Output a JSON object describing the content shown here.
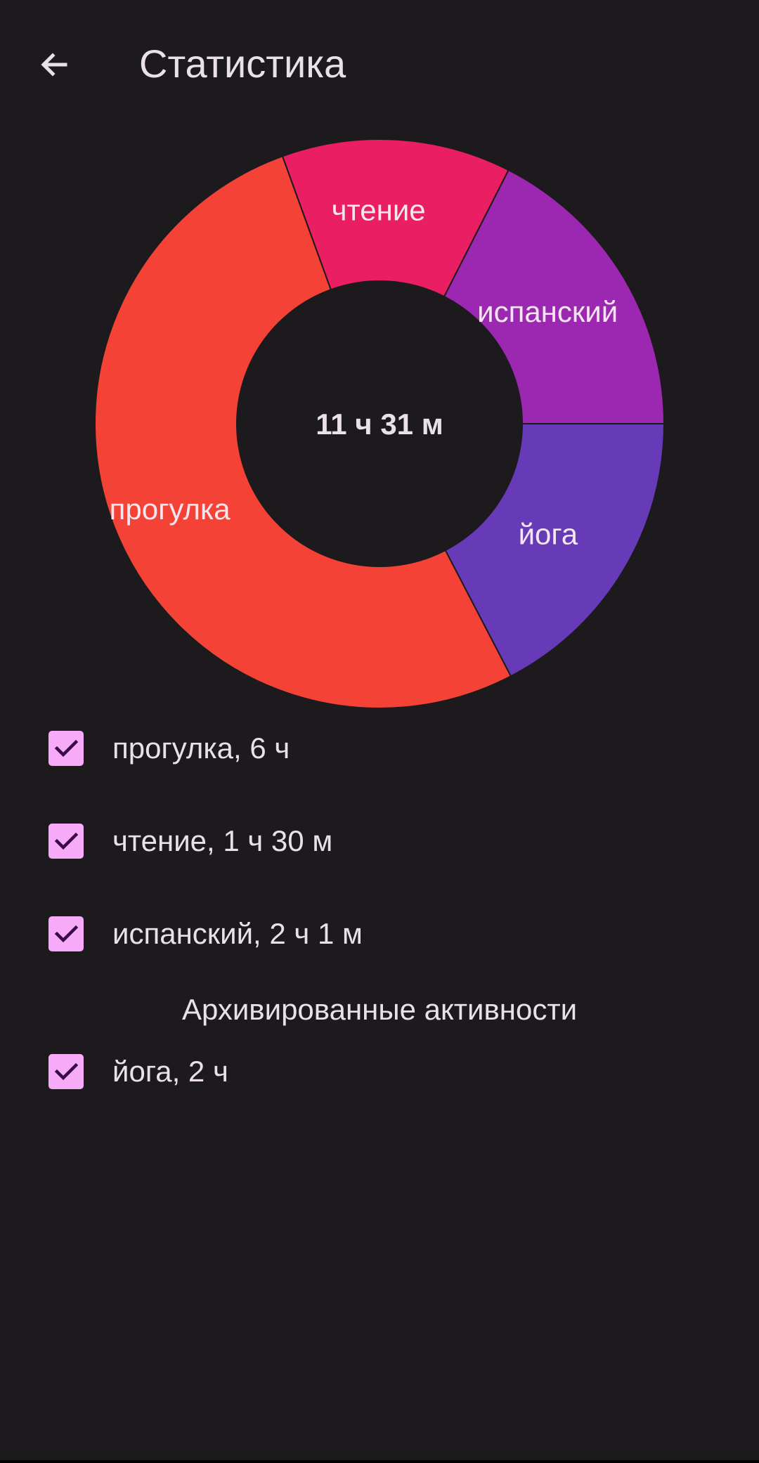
{
  "app_bar": {
    "title": "Статистика",
    "back_icon": "arrow-left-icon"
  },
  "colors": {
    "background": "#1d1a1e",
    "text": "#e9e1e6",
    "checkbox_fill": "#f7aaf8",
    "checkbox_check": "#3a0a48"
  },
  "chart_data": {
    "type": "pie",
    "total_label": "11 ч 31 м",
    "slices": [
      {
        "label": "йога",
        "minutes": 120,
        "color": "#673ab7"
      },
      {
        "label": "прогулка",
        "minutes": 360,
        "color": "#f44336"
      },
      {
        "label": "чтение",
        "minutes": 90,
        "color": "#e91e63"
      },
      {
        "label": "испанский",
        "minutes": 121,
        "color": "#9c27b0"
      }
    ]
  },
  "activities": [
    {
      "label": "прогулка, 6 ч",
      "checked": true
    },
    {
      "label": "чтение, 1 ч 30 м",
      "checked": true
    },
    {
      "label": "испанский, 2 ч 1 м",
      "checked": true
    }
  ],
  "archived_header": "Архивированные активности",
  "archived": [
    {
      "label": "йога, 2 ч",
      "checked": true
    }
  ]
}
